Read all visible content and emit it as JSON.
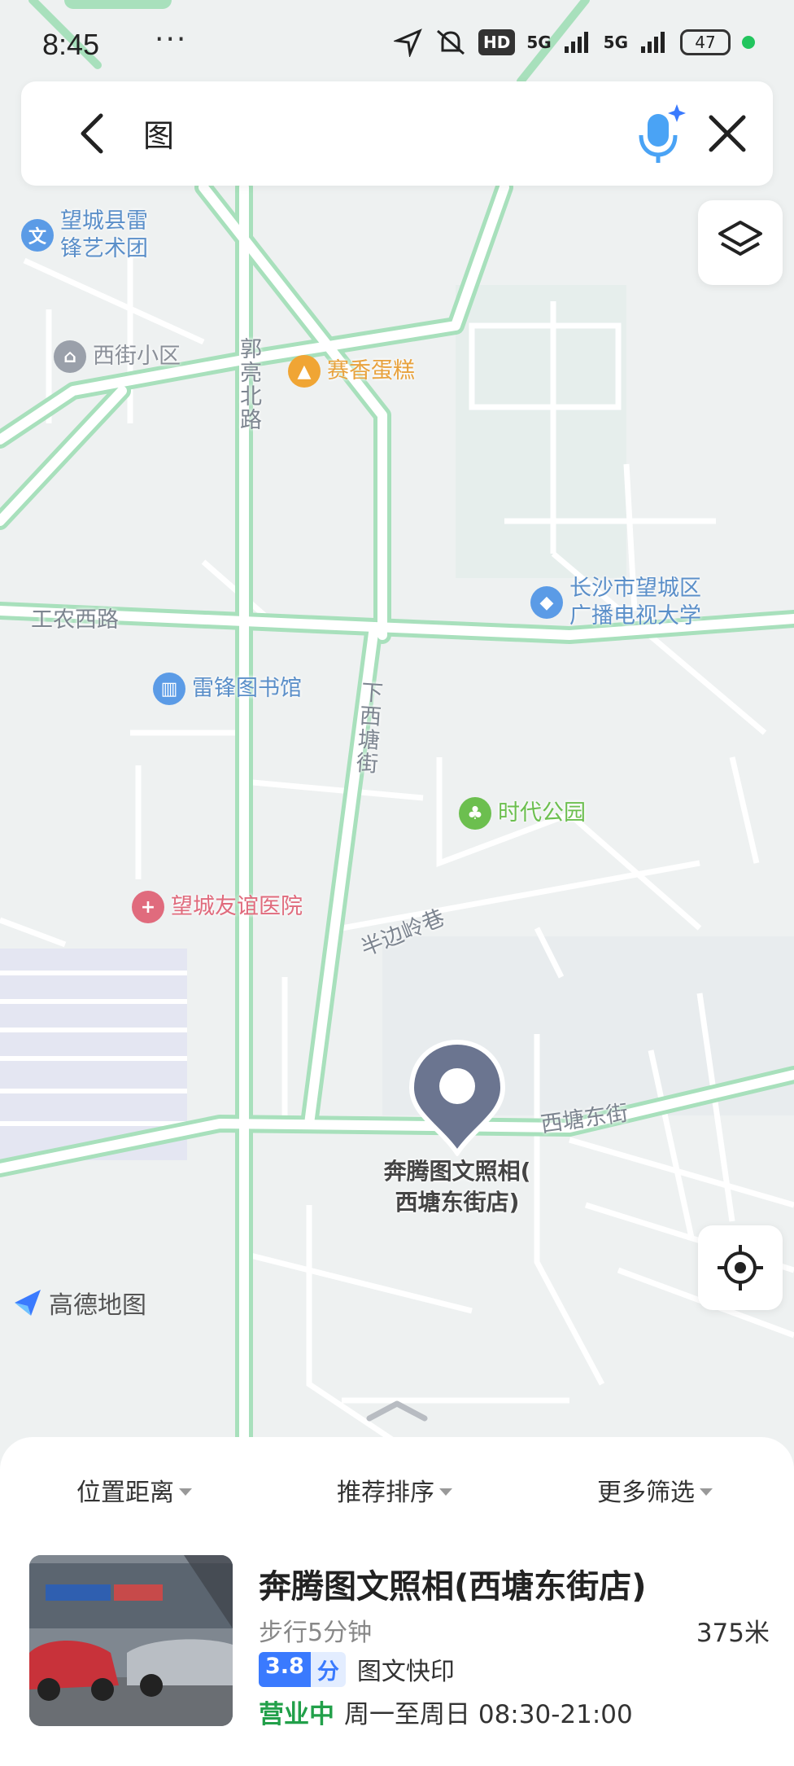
{
  "status_bar": {
    "time": "8:45",
    "more": "···",
    "hd": "HD",
    "signal1": "5G",
    "signal2": "5G",
    "battery": "47"
  },
  "search": {
    "query": "图"
  },
  "map": {
    "pois": {
      "art_troupe": "望城县雷\n锋艺术团",
      "xijie": "西街小区",
      "cake": "赛香蛋糕",
      "tv_university": "长沙市望城区\n广播电视大学",
      "library": "雷锋图书馆",
      "park": "时代公园",
      "hospital": "望城友谊医院"
    },
    "roads": {
      "guoliang": "郭亮北路",
      "gongnong": "工农西路",
      "xiaxitang": "下西塘街",
      "banbianling": "半边岭巷",
      "xitangdong": "西塘东街"
    },
    "marker_label": "奔腾图文照相(\n西塘东街店)",
    "logo": "高德地图"
  },
  "filters": {
    "distance": "位置距离",
    "sort": "推荐排序",
    "more": "更多筛选"
  },
  "result": {
    "title": "奔腾图文照相(西塘东街店)",
    "walk": "步行5分钟",
    "distance": "375米",
    "score": "3.8",
    "score_unit": "分",
    "category": "图文快印",
    "status": "营业中",
    "hours": "周一至周日 08:30-21:00"
  },
  "colors": {
    "road_outline": "#a8e0bc",
    "accent_blue": "#3a7afe",
    "open_green": "#22a04a",
    "marker": "#6b7590"
  }
}
